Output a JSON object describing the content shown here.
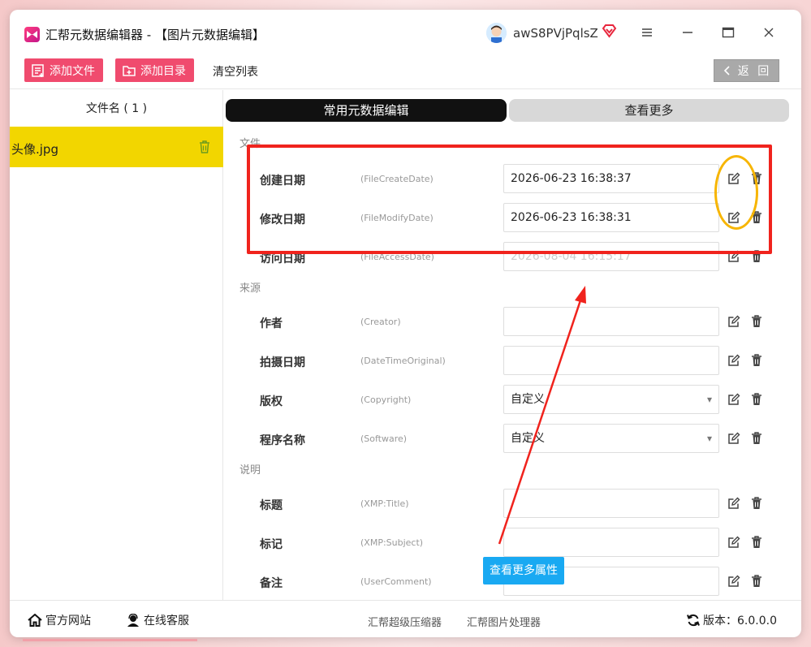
{
  "window": {
    "title": "汇帮元数据编辑器 - 【图片元数据编辑】",
    "username": "awS8PVjPqlsZ"
  },
  "toolbar": {
    "add_file": "添加文件",
    "add_dir": "添加目录",
    "clear_list": "清空列表",
    "back": "返 回"
  },
  "file_list": {
    "header": "文件名 ( 1 )",
    "items": [
      {
        "name": "头像.jpg"
      }
    ]
  },
  "tabs": {
    "common": "常用元数据编辑",
    "more": "查看更多"
  },
  "sections": {
    "file": "文件",
    "source": "来源",
    "description": "说明"
  },
  "fields": [
    {
      "label": "创建日期",
      "key": "(FileCreateDate)",
      "value": "2026-06-23 16:38:37",
      "type": "text"
    },
    {
      "label": "修改日期",
      "key": "(FileModifyDate)",
      "value": "2026-06-23 16:38:31",
      "type": "text"
    },
    {
      "label": "访问日期",
      "key": "(FileAccessDate)",
      "value": "2026-08-04 16:15:17",
      "type": "readonly"
    },
    {
      "label": "作者",
      "key": "(Creator)",
      "value": "",
      "type": "text"
    },
    {
      "label": "拍摄日期",
      "key": "(DateTimeOriginal)",
      "value": "",
      "type": "text"
    },
    {
      "label": "版权",
      "key": "(Copyright)",
      "value": "自定义",
      "type": "select"
    },
    {
      "label": "程序名称",
      "key": "(Software)",
      "value": "自定义",
      "type": "select"
    },
    {
      "label": "标题",
      "key": "(XMP:Title)",
      "value": "",
      "type": "text"
    },
    {
      "label": "标记",
      "key": "(XMP:Subject)",
      "value": "",
      "type": "text"
    },
    {
      "label": "备注",
      "key": "(UserComment)",
      "value": "",
      "type": "text"
    }
  ],
  "tooltip": "查看更多属性",
  "footer": {
    "official_site": "官方网站",
    "online_service": "在线客服",
    "compressor": "汇帮超级压缩器",
    "image_processor": "汇帮图片处理器",
    "version": "版本：6.0.0.0"
  },
  "colors": {
    "accent": "#f04b6e",
    "file_highlight": "#f2d600",
    "annotation_red": "#f0231d",
    "annotation_yellow": "#f7b500",
    "tooltip_blue": "#19a9f2"
  }
}
